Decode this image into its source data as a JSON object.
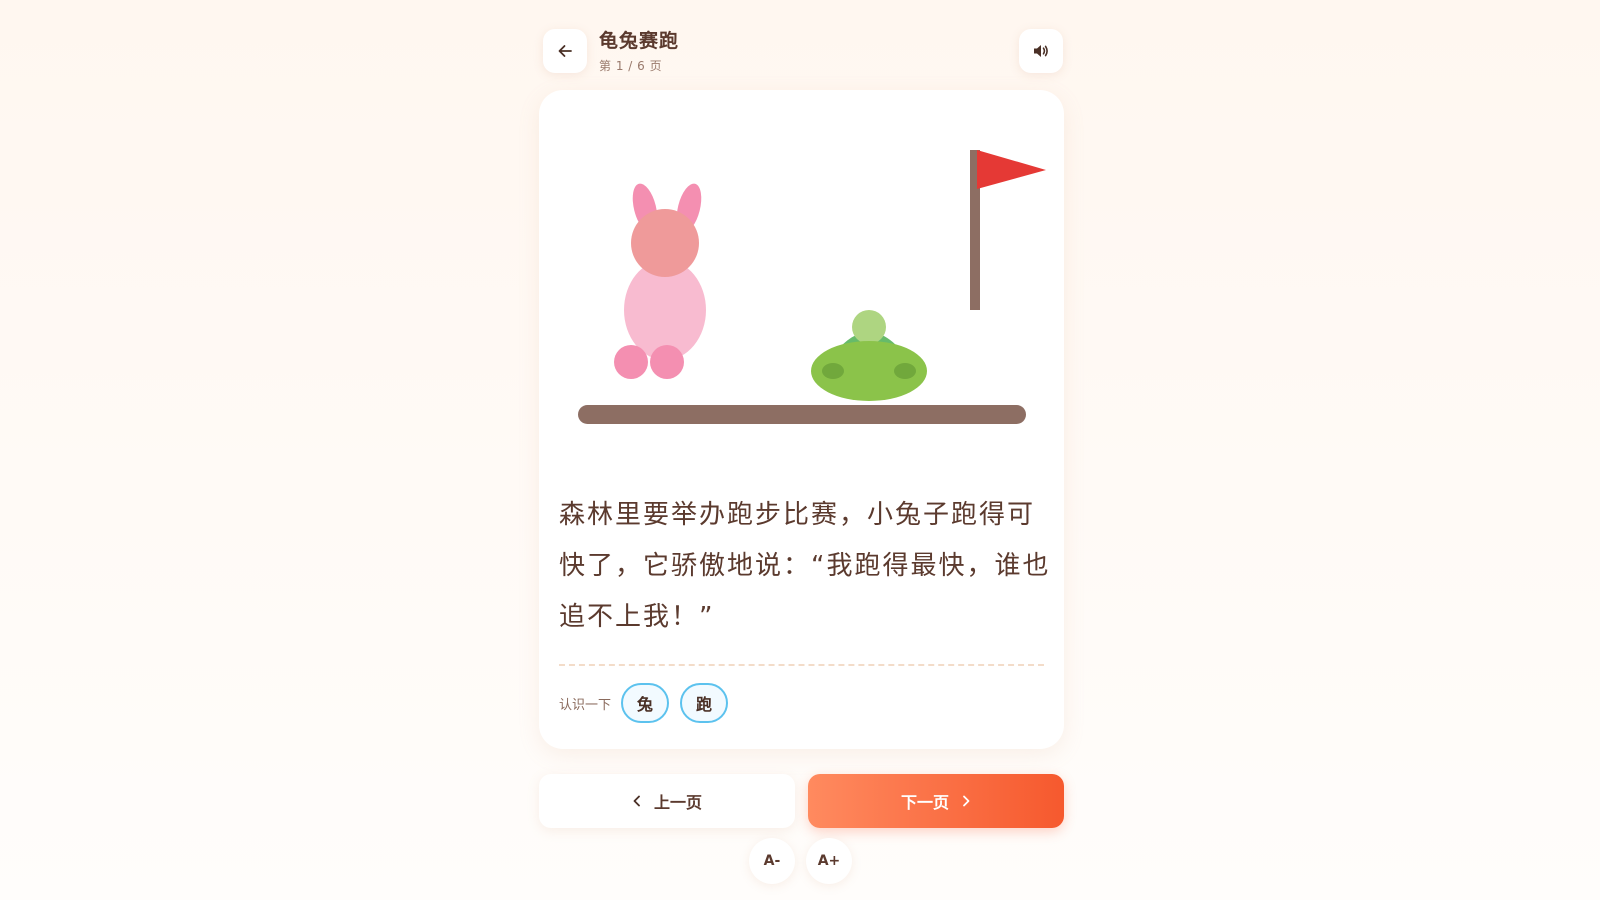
{
  "header": {
    "title": "龟兔赛跑",
    "page_indicator": "第 1 / 6 页",
    "back_icon": "arrow-left-icon",
    "sound_icon": "speaker-icon"
  },
  "story": {
    "text": "森林里要举办跑步比赛，小兔子跑得可快了，它骄傲地说：“我跑得最快，谁也追不上我！”"
  },
  "illustration": {
    "colors": {
      "rabbit_ear": "#f48fb1",
      "rabbit_head": "#ef9a9a",
      "rabbit_body": "#f8bbd0",
      "rabbit_feet": "#f48fb1",
      "turtle_shell": "#8bc34a",
      "turtle_shell_top": "#66bb6a",
      "turtle_head": "#aed581",
      "turtle_spots": "#689f38",
      "ground": "#8d6e63",
      "flag_pole": "#8d6e63",
      "flag": "#e53935"
    }
  },
  "vocab": {
    "label": "认识一下",
    "words": [
      "兔",
      "跑"
    ]
  },
  "navigation": {
    "prev_label": "上一页",
    "next_label": "下一页"
  },
  "font_controls": {
    "decrease_label": "A-",
    "increase_label": "A+"
  },
  "colors": {
    "accent_start": "#ff8a5f",
    "accent_end": "#f6592e",
    "text": "#5b3a2e",
    "chip_border": "#5cc2ee"
  }
}
